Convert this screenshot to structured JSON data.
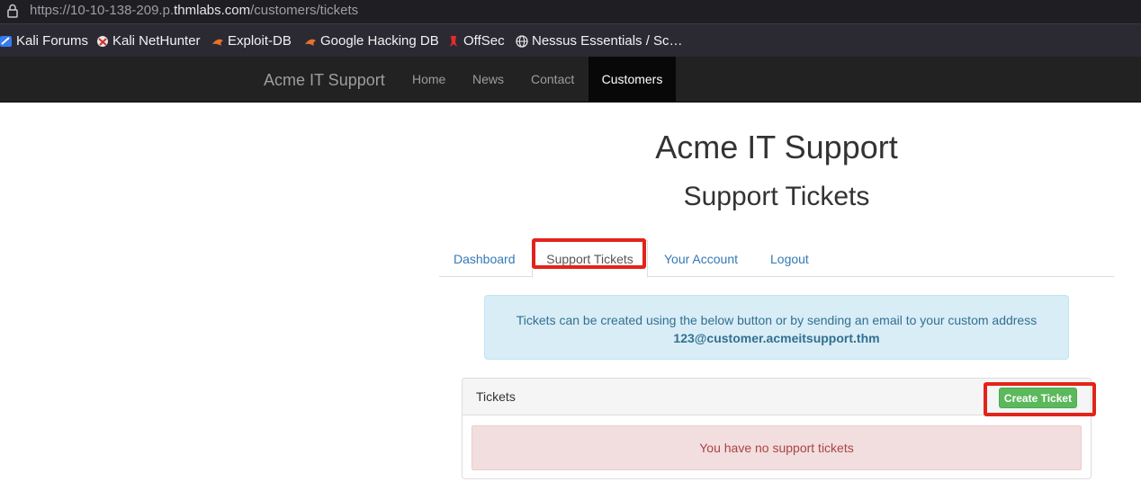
{
  "browser": {
    "url_prefix": "https://10-10-138-209.p.",
    "url_host": "thmlabs.com",
    "url_path": "/customers/tickets",
    "bookmarks": [
      {
        "label": "Kali Forums",
        "icon": "kali-forums-icon"
      },
      {
        "label": "Kali NetHunter",
        "icon": "kali-nethunter-icon"
      },
      {
        "label": "Exploit-DB",
        "icon": "exploit-db-icon"
      },
      {
        "label": "Google Hacking DB",
        "icon": "google-hacking-db-icon"
      },
      {
        "label": "OffSec",
        "icon": "offsec-icon"
      },
      {
        "label": "Nessus Essentials / Sc…",
        "icon": "globe-icon"
      }
    ]
  },
  "navbar": {
    "brand": "Acme IT Support",
    "links": [
      "Home",
      "News",
      "Contact"
    ],
    "active": "Customers"
  },
  "page": {
    "title": "Acme IT Support",
    "subtitle": "Support Tickets"
  },
  "tabs": {
    "items": [
      "Dashboard",
      "Support Tickets",
      "Your Account",
      "Logout"
    ],
    "active_index": 1
  },
  "alert": {
    "text": "Tickets can be created using the below button or by sending an email to your custom address",
    "email": "123@customer.acmeitsupport.thm"
  },
  "panel": {
    "title": "Tickets",
    "create_button": "Create Ticket",
    "empty_message": "You have no support tickets"
  },
  "colors": {
    "highlight": "#e3231a",
    "navbar_bg": "#222222",
    "link": "#337ab7",
    "success": "#5cb85c"
  }
}
